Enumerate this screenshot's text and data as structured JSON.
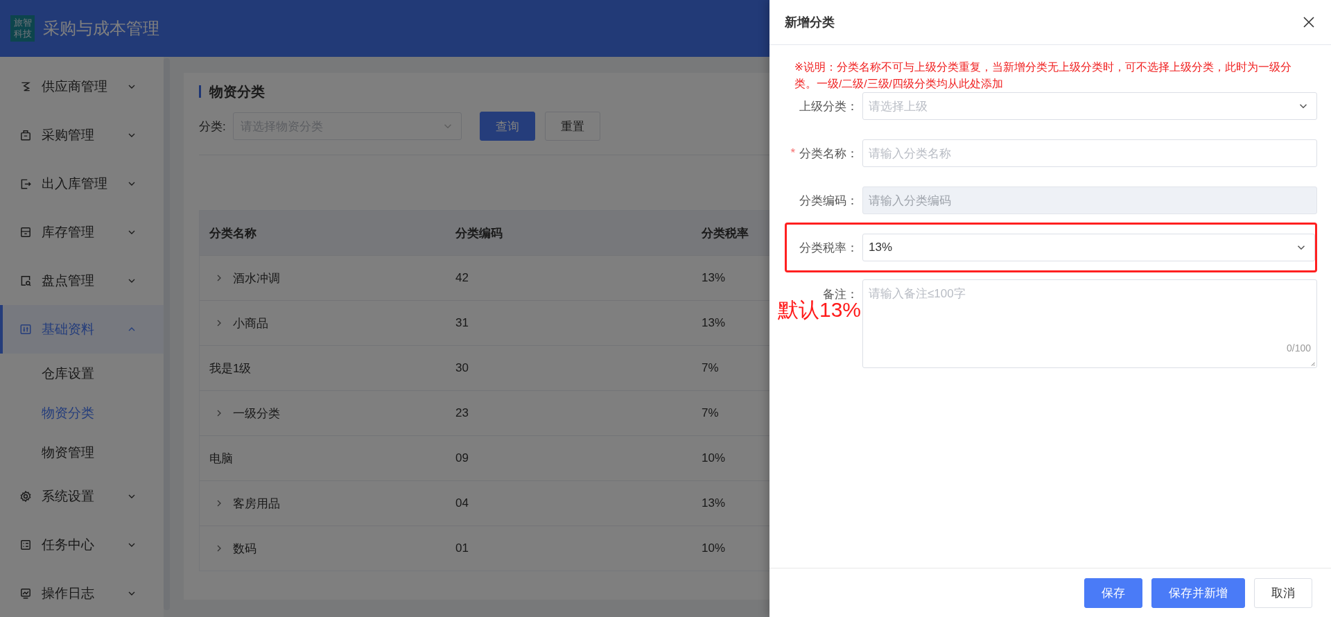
{
  "app": {
    "logo_lines": [
      "旅智",
      "科技"
    ],
    "title": "采购与成本管理"
  },
  "sidebar": {
    "items": [
      {
        "label": "供应商管理",
        "expanded": false,
        "selected": false
      },
      {
        "label": "采购管理",
        "expanded": false,
        "selected": false
      },
      {
        "label": "出入库管理",
        "expanded": false,
        "selected": false
      },
      {
        "label": "库存管理",
        "expanded": false,
        "selected": false
      },
      {
        "label": "盘点管理",
        "expanded": false,
        "selected": false
      },
      {
        "label": "基础资料",
        "expanded": true,
        "selected": true,
        "children": [
          {
            "label": "仓库设置",
            "selected": false
          },
          {
            "label": "物资分类",
            "selected": true
          },
          {
            "label": "物资管理",
            "selected": false
          }
        ]
      },
      {
        "label": "系统设置",
        "expanded": false,
        "selected": false
      },
      {
        "label": "任务中心",
        "expanded": false,
        "selected": false
      },
      {
        "label": "操作日志",
        "expanded": false,
        "selected": false
      }
    ]
  },
  "page": {
    "title": "物资分类",
    "filter": {
      "label": "分类:",
      "placeholder": "请选择物资分类"
    },
    "buttons": [
      {
        "label": "查询",
        "kind": "primary"
      },
      {
        "label": "重置",
        "kind": "default"
      }
    ],
    "table": {
      "columns": [
        "分类名称",
        "分类编码",
        "分类税率"
      ],
      "rows": [
        {
          "cells": [
            "酒水冲调",
            "42",
            "13%"
          ],
          "expandable": true
        },
        {
          "cells": [
            "小商品",
            "31",
            "13%"
          ],
          "expandable": true
        },
        {
          "cells": [
            "我是1级",
            "30",
            "7%"
          ],
          "expandable": false
        },
        {
          "cells": [
            "一级分类",
            "23",
            "7%"
          ],
          "expandable": true
        },
        {
          "cells": [
            "电脑",
            "09",
            "10%"
          ],
          "expandable": false
        },
        {
          "cells": [
            "客房用品",
            "04",
            "13%"
          ],
          "expandable": true
        },
        {
          "cells": [
            "数码",
            "01",
            "10%"
          ],
          "expandable": true
        }
      ]
    }
  },
  "drawer": {
    "title": "新增分类",
    "note": "※说明：分类名称不可与上级分类重复，当新增分类无上级分类时，可不选择上级分类，此时为一级分类。一级/二级/三级/四级分类均从此处添加",
    "fields": [
      {
        "kind": "select",
        "label": "上级分类：",
        "placeholder": "请选择上级",
        "highlighted": false
      },
      {
        "kind": "input",
        "label": "分类名称：",
        "required_mark": "*",
        "placeholder": "请输入分类名称",
        "disabled": false,
        "highlighted": false
      },
      {
        "kind": "input",
        "label": "分类编码：",
        "placeholder": "请输入分类编码",
        "disabled": true,
        "highlighted": false
      },
      {
        "kind": "select",
        "label": "分类税率：",
        "value": "13%",
        "highlighted": true
      },
      {
        "kind": "textarea",
        "label": "备注：",
        "placeholder": "请输入备注≤100字",
        "counter": "0/100",
        "highlighted": false
      }
    ],
    "annotation": "默认13%",
    "buttons": [
      {
        "label": "保存",
        "kind": "primary"
      },
      {
        "label": "保存并新增",
        "kind": "primary"
      },
      {
        "label": "取消",
        "kind": "default"
      }
    ]
  }
}
